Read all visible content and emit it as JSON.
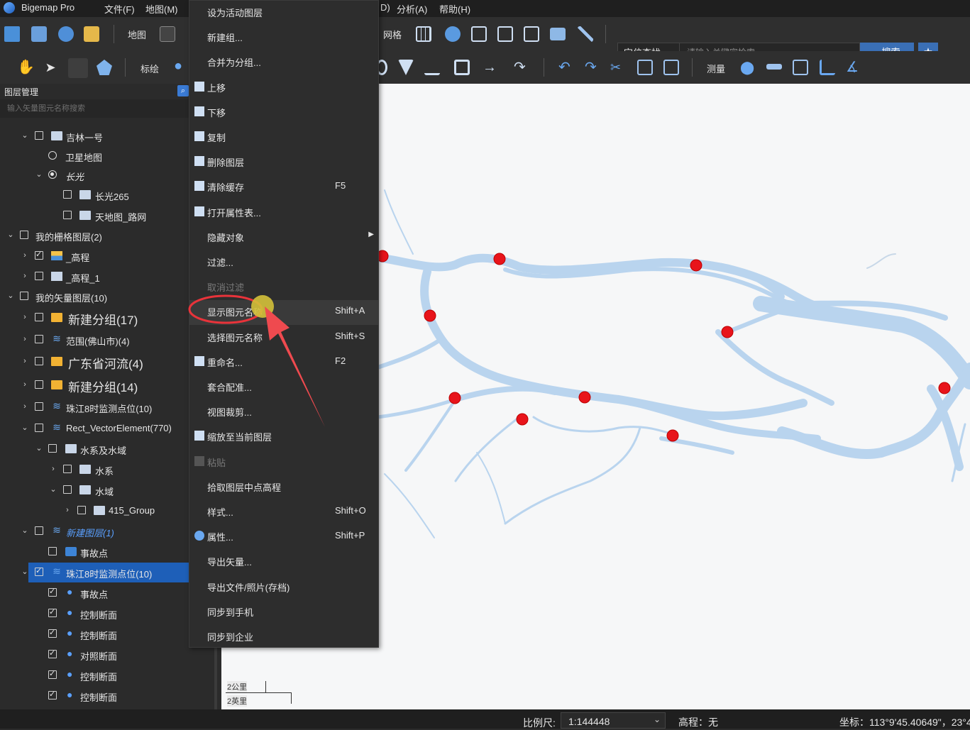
{
  "app": {
    "title": "Bigemap Pro"
  },
  "menubar": {
    "items": [
      "文件(F)",
      "地图(M)",
      "D)",
      "分析(A)",
      "帮助(H)"
    ]
  },
  "toolbar": {
    "map_label": "地图",
    "grid_label": "网格",
    "draw_label": "标绘",
    "measure_label": "测量",
    "search_type": "定位查找",
    "search_placeholder": "请输入关键字检索",
    "search_button": "搜索"
  },
  "layer_panel": {
    "title": "图层管理",
    "search_placeholder": "输入矢量图元名称搜索",
    "rows": [
      "吉林一号",
      "卫星地图",
      "长光",
      "长光265",
      "天地图_路网",
      "我的栅格图层(2)",
      "_高程",
      "_高程_1",
      "我的矢量图层(10)",
      "新建分组(17)",
      "范围(佛山市)(4)",
      "广东省河流(4)",
      "新建分组(14)",
      "珠江8时监测点位(10)",
      "Rect_VectorElement(770)",
      "水系及水域",
      "水系",
      "水域",
      "415_Group",
      "新建图层(1)",
      "事故点",
      "珠江8时监测点位(10)",
      "事故点",
      "控制断面",
      "控制断面",
      "对照断面",
      "控制断面",
      "控制断面"
    ]
  },
  "context_menu": {
    "items": [
      {
        "label": "设为活动图层",
        "shortcut": ""
      },
      {
        "label": "新建组...",
        "shortcut": ""
      },
      {
        "label": "合并为分组...",
        "shortcut": ""
      },
      {
        "label": "上移",
        "shortcut": ""
      },
      {
        "label": "下移",
        "shortcut": ""
      },
      {
        "label": "复制",
        "shortcut": ""
      },
      {
        "label": "删除图层",
        "shortcut": ""
      },
      {
        "label": "清除缓存",
        "shortcut": "F5"
      },
      {
        "label": "打开属性表...",
        "shortcut": ""
      },
      {
        "label": "隐藏对象",
        "shortcut": ""
      },
      {
        "label": "过滤...",
        "shortcut": ""
      },
      {
        "label": "取消过滤",
        "shortcut": ""
      },
      {
        "label": "显示图元名称",
        "shortcut": "Shift+A"
      },
      {
        "label": "选择图元名称",
        "shortcut": "Shift+S"
      },
      {
        "label": "重命名...",
        "shortcut": "F2"
      },
      {
        "label": "套合配准...",
        "shortcut": ""
      },
      {
        "label": "视图裁剪...",
        "shortcut": ""
      },
      {
        "label": "缩放至当前图层",
        "shortcut": ""
      },
      {
        "label": "粘贴",
        "shortcut": ""
      },
      {
        "label": "拾取图层中点高程",
        "shortcut": ""
      },
      {
        "label": "样式...",
        "shortcut": "Shift+O"
      },
      {
        "label": "属性...",
        "shortcut": "Shift+P"
      },
      {
        "label": "导出矢量...",
        "shortcut": ""
      },
      {
        "label": "导出文件/照片(存档)",
        "shortcut": ""
      },
      {
        "label": "同步到手机",
        "shortcut": ""
      },
      {
        "label": "同步到企业",
        "shortcut": ""
      }
    ]
  },
  "map": {
    "scale_top": "2公里",
    "scale_bottom": "2英里",
    "marker_color": "#e8141b",
    "river_color": "#b9d4ee"
  },
  "statusbar": {
    "scale_label": "比例尺:",
    "scale_value": "1:144448",
    "elevation": "高程：无",
    "coords": "坐标：113°9'45.40649\"，23°4"
  },
  "colors": {
    "accent": "#3a6fb5",
    "selected_row": "#1e5fb8",
    "annotation": "#e8333a"
  }
}
